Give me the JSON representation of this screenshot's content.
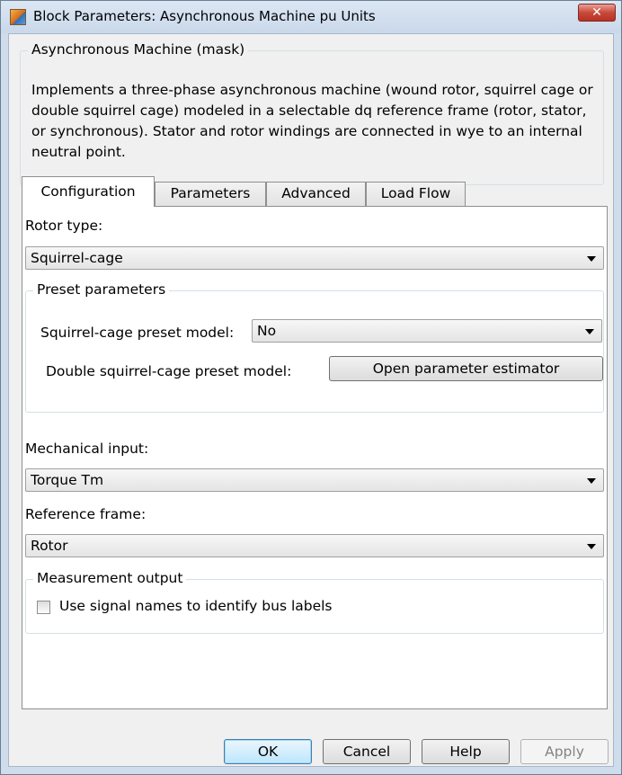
{
  "window": {
    "title": "Block Parameters: Asynchronous Machine pu Units",
    "close_glyph": "✕"
  },
  "mask": {
    "group_label": "Asynchronous Machine (mask)",
    "description": "Implements a three-phase asynchronous machine (wound rotor, squirrel cage or double squirrel cage) modeled in a selectable dq reference frame (rotor, stator, or synchronous). Stator and rotor windings are connected in wye to an internal neutral point."
  },
  "tabs": [
    {
      "label": "Configuration",
      "active": true
    },
    {
      "label": "Parameters",
      "active": false
    },
    {
      "label": "Advanced",
      "active": false
    },
    {
      "label": "Load Flow",
      "active": false
    }
  ],
  "configuration": {
    "rotor_type": {
      "label": "Rotor type:",
      "value": "Squirrel-cage"
    },
    "preset": {
      "group_label": "Preset parameters",
      "squirrel_cage_label": "Squirrel-cage preset model:",
      "squirrel_cage_value": "No",
      "double_cage_label": "Double squirrel-cage preset model:",
      "estimator_button": "Open parameter estimator"
    },
    "mechanical_input": {
      "label": "Mechanical input:",
      "value": "Torque Tm"
    },
    "reference_frame": {
      "label": "Reference frame:",
      "value": "Rotor"
    },
    "measurement": {
      "group_label": "Measurement output",
      "checkbox_label": "Use signal names to identify bus labels",
      "checked": false
    }
  },
  "buttons": {
    "ok": "OK",
    "cancel": "Cancel",
    "help": "Help",
    "apply": "Apply"
  },
  "colors": {
    "title_bar": "#cfdceb",
    "close_button": "#c9483a",
    "dialog_background": "#f0f0f0",
    "panel_background": "#ffffff"
  }
}
